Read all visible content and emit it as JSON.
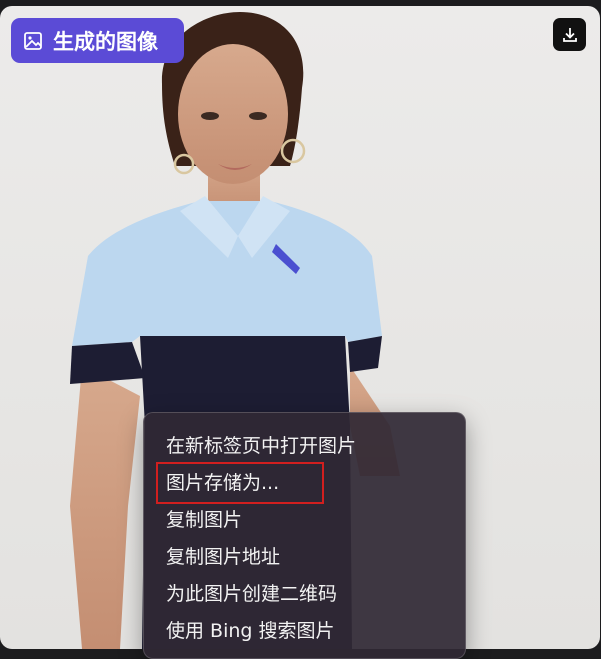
{
  "badge": {
    "label": "生成的图像",
    "icon": "image-icon"
  },
  "download": {
    "icon": "download-icon"
  },
  "context_menu": {
    "items": [
      "在新标签页中打开图片",
      "图片存储为...",
      "复制图片",
      "复制图片地址",
      "为此图片创建二维码",
      "使用 Bing 搜索图片"
    ]
  },
  "colors": {
    "badge": "#5b4bd6",
    "highlight": "#d21f1f",
    "menu_bg": "#302834"
  }
}
